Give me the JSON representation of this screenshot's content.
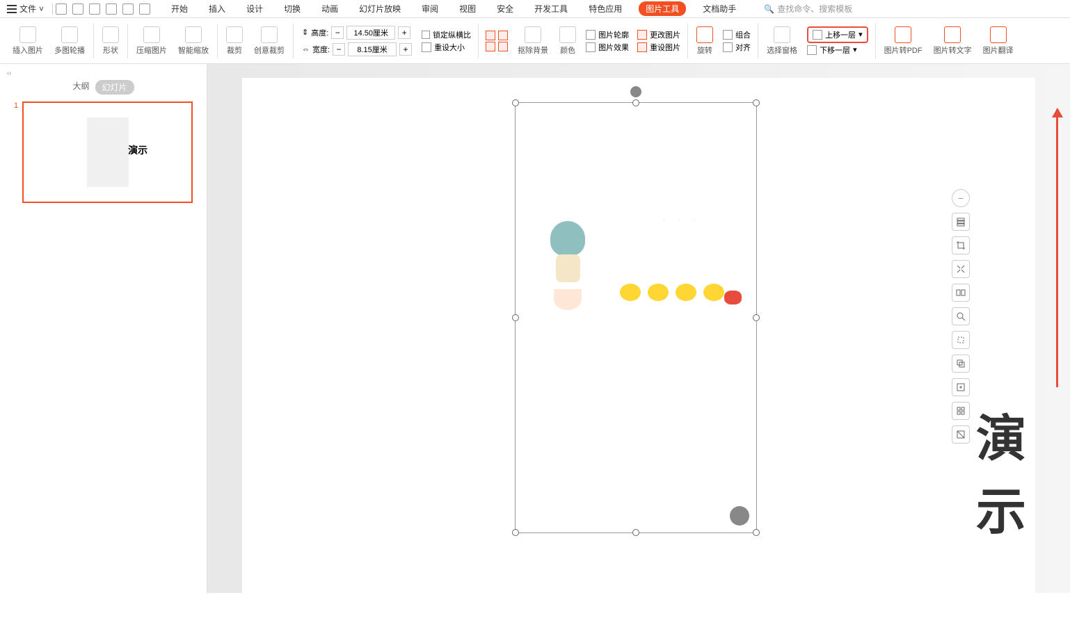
{
  "menu": {
    "file": "文件",
    "tabs": [
      "开始",
      "插入",
      "设计",
      "切换",
      "动画",
      "幻灯片放映",
      "审阅",
      "视图",
      "安全",
      "开发工具",
      "特色应用",
      "图片工具",
      "文档助手"
    ],
    "active_tab": "图片工具",
    "search_placeholder": "查找命令、搜索模板"
  },
  "toolbar": {
    "insert_image": "插入图片",
    "multi_outline": "多图轮播",
    "shape": "形状",
    "compress": "压缩图片",
    "smart_scale": "智能缩放",
    "crop": "裁剪",
    "creative_crop": "创意裁剪",
    "height_label": "高度:",
    "height_value": "14.50厘米",
    "width_label": "宽度:",
    "width_value": "8.15厘米",
    "lock_ratio": "锁定纵横比",
    "reset_size": "重设大小",
    "remove_bg": "抠除背景",
    "color": "颜色",
    "image_outline": "图片轮廓",
    "image_effect": "图片效果",
    "change_image": "更改图片",
    "reset_image": "重设图片",
    "rotate": "旋转",
    "group": "组合",
    "align": "对齐",
    "select_pane": "选择窗格",
    "bring_forward": "上移一层",
    "send_backward": "下移一层",
    "to_pdf": "图片转PDF",
    "to_text": "图片转文字",
    "translate": "图片翻译"
  },
  "sidebar": {
    "outline": "大纲",
    "slides": "幻灯片",
    "slide_num": "1",
    "thumb_text": "演示"
  },
  "canvas": {
    "big_text": "演示",
    "dots": ". . ."
  }
}
